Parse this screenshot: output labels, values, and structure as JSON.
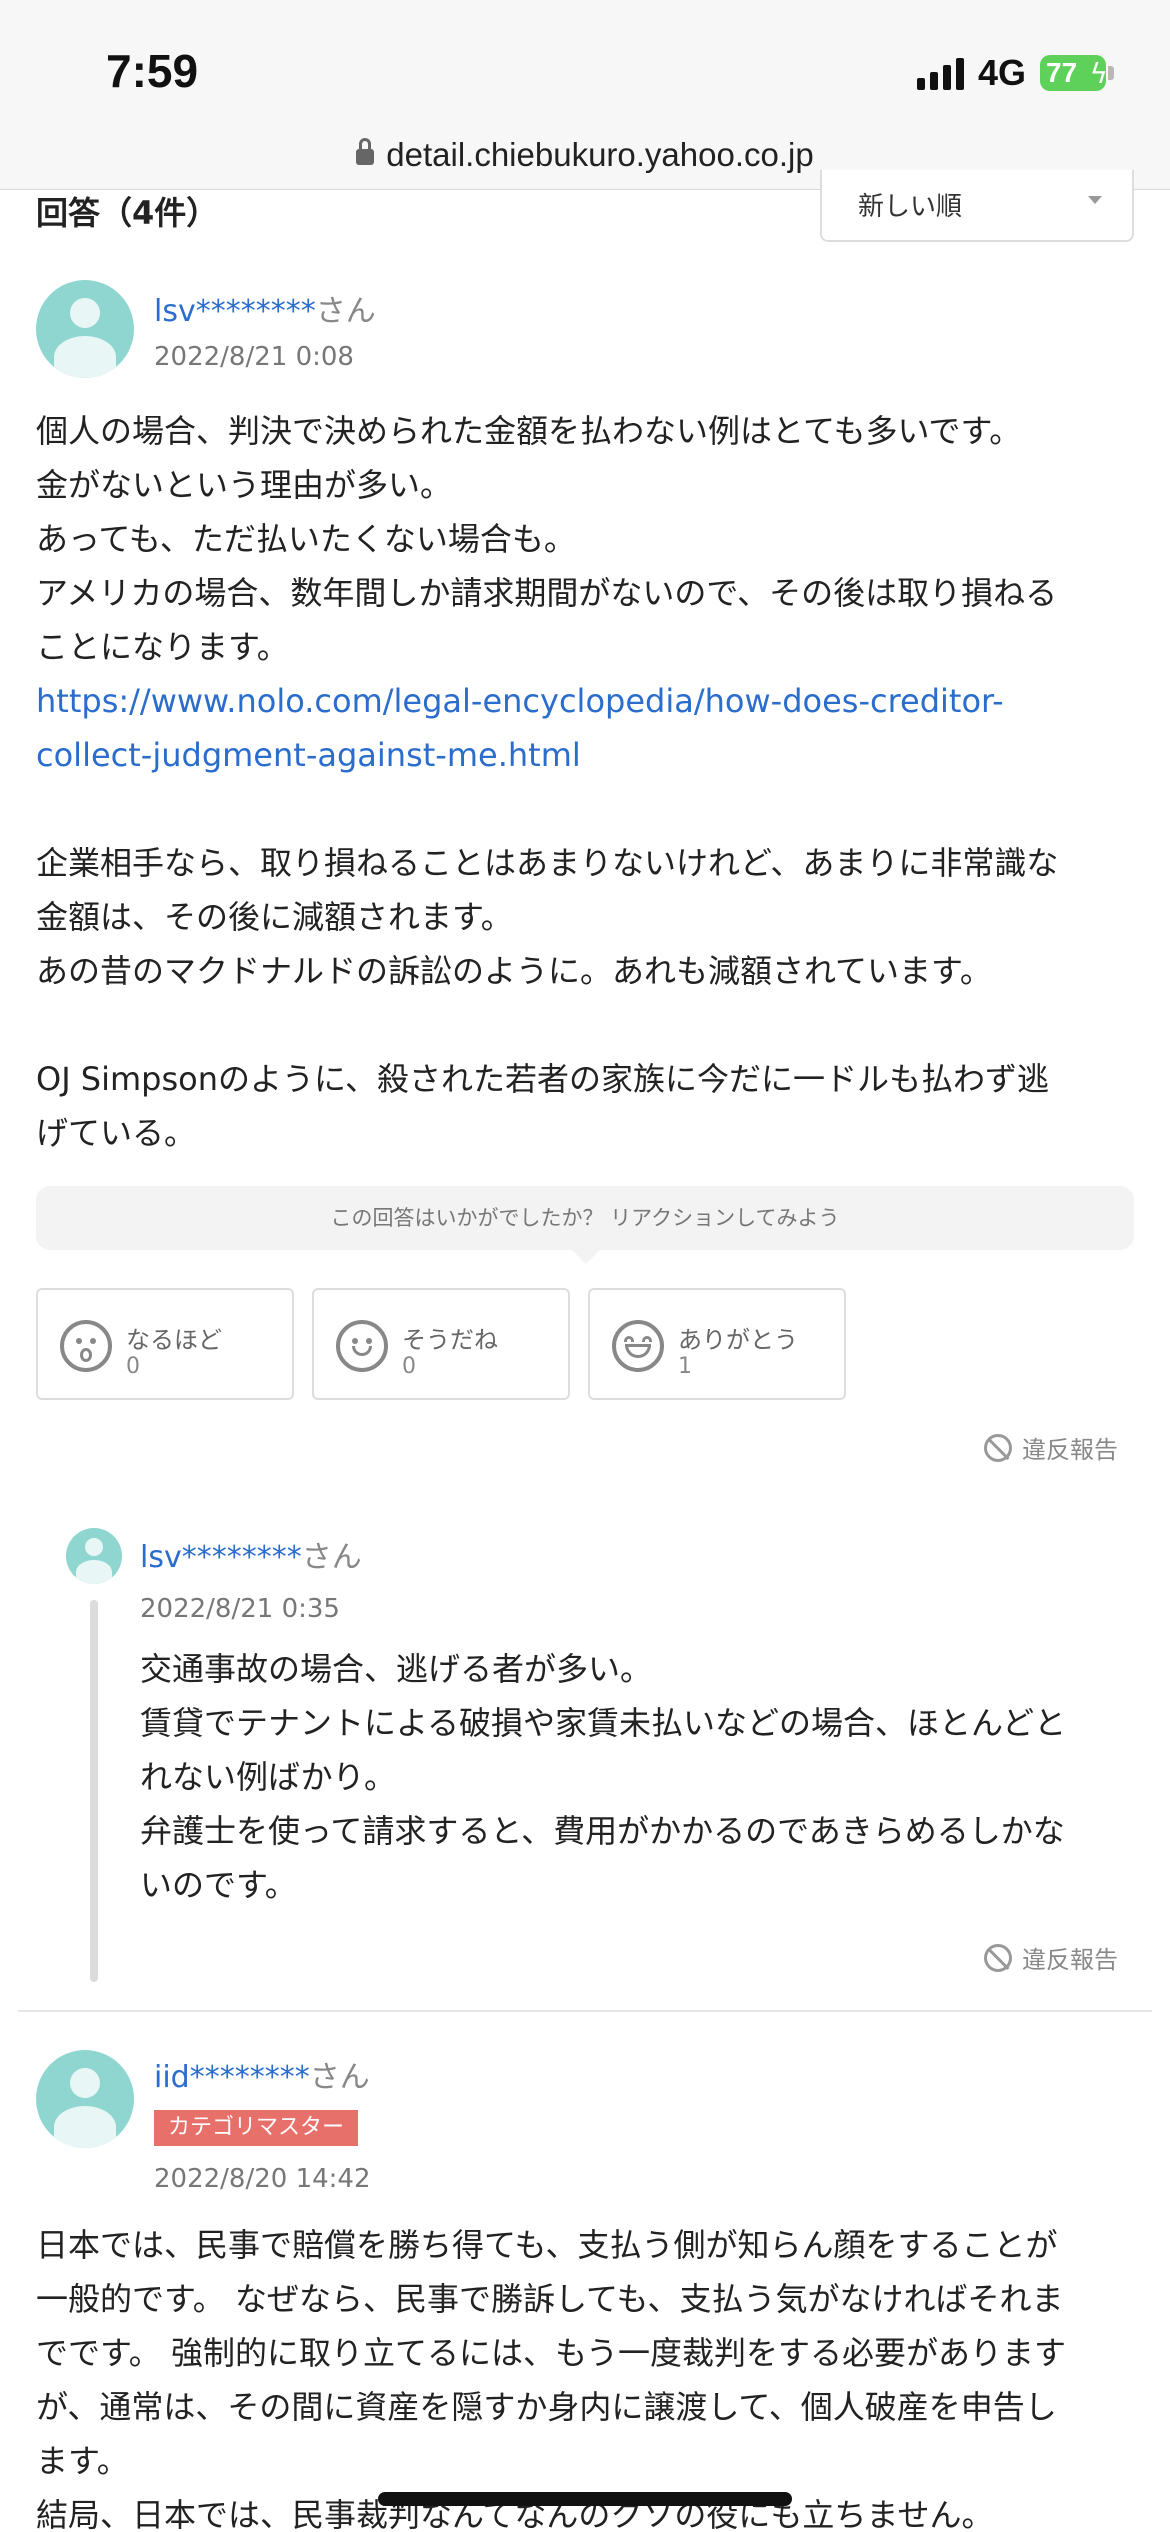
{
  "status_bar": {
    "time": "7:59",
    "network": "4G",
    "battery_percent": "77",
    "battery_color": "#5ed15a"
  },
  "browser": {
    "url": "detail.chiebukuro.yahoo.co.jp"
  },
  "answers_header": {
    "title": "回答（4件）",
    "sort_selected": "新しい順"
  },
  "answers": [
    {
      "user": "lsv********",
      "honorific": "さん",
      "date": "2022/8/21 0:08",
      "body_lines": [
        "個人の場合、判決で決められた金額を払わない例はとても多いです。",
        "金がないという理由が多い。",
        "あっても、ただ払いたくない場合も。",
        "アメリカの場合、数年間しか請求期間がないので、その後は取り損ねる",
        "ことになります。"
      ],
      "link_lines": [
        "https://www.nolo.com/legal-encyclopedia/how-does-creditor-",
        "collect-judgment-against-me.html"
      ],
      "body_lines_2": [
        "企業相手なら、取り損ねることはあまりないけれど、あまりに非常識な",
        "金額は、その後に減額されます。",
        "あの昔のマクドナルドの訴訟のように。あれも減額されています。"
      ],
      "body_lines_3": [
        "OJ Simpsonのように、殺された若者の家族に今だに一ドルも払わず逃",
        "げている。"
      ],
      "reaction_prompt": "この回答はいかがでしたか？ リアクションしてみよう",
      "reactions": [
        {
          "label": "なるほど",
          "count": "0",
          "icon": "surprised-face-icon"
        },
        {
          "label": "そうだね",
          "count": "0",
          "icon": "smile-face-icon"
        },
        {
          "label": "ありがとう",
          "count": "1",
          "icon": "grin-face-icon"
        }
      ],
      "report_label": "違反報告",
      "reply": {
        "user": "lsv********",
        "honorific": "さん",
        "date": "2022/8/21 0:35",
        "body_lines": [
          "交通事故の場合、逃げる者が多い。",
          "賃貸でテナントによる破損や家賃未払いなどの場合、ほとんどと",
          "れない例ばかり。",
          "弁護士を使って請求すると、費用がかかるのであきらめるしかな",
          "いのです。"
        ],
        "report_label": "違反報告"
      }
    },
    {
      "user": "iid********",
      "honorific": "さん",
      "badge": "カテゴリマスター",
      "badge_color": "#e8706b",
      "date": "2022/8/20 14:42",
      "body_lines": [
        "日本では、民事で賠償を勝ち得ても、支払う側が知らん顔をすることが",
        "一般的です。 なぜなら、民事で勝訴しても、支払う気がなければそれま",
        "でです。 強制的に取り立てるには、もう一度裁判をする必要があります",
        "が、通常は、その間に資産を隠すか身内に譲渡して、個人破産を申告し",
        "ます。",
        "結局、日本では、民事裁判なんてなんのクソの役にも立ちません。"
      ]
    }
  ],
  "colors": {
    "link": "#2a6dcc",
    "avatar": "#8fd6d1"
  }
}
